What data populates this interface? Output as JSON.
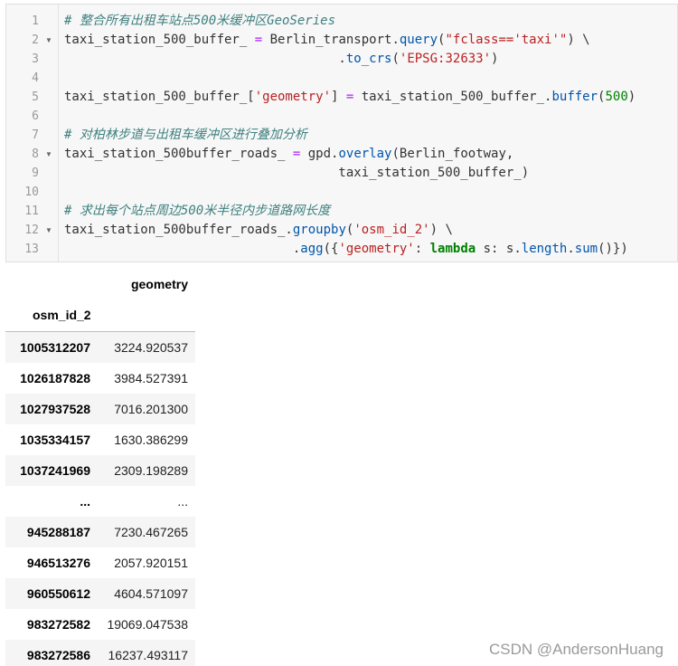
{
  "code_cell": {
    "lines": [
      {
        "num": "1",
        "fold": "",
        "tokens": [
          {
            "t": "# 整合所有出租车站点500米缓冲区GeoSeries",
            "c": "tk-comment"
          }
        ]
      },
      {
        "num": "2",
        "fold": "▼",
        "tokens": [
          {
            "t": "taxi_station_500_buffer_ ",
            "c": "tk-plain"
          },
          {
            "t": "=",
            "c": "tk-op"
          },
          {
            "t": " Berlin_transport.",
            "c": "tk-plain"
          },
          {
            "t": "query",
            "c": "tk-attr"
          },
          {
            "t": "(",
            "c": "tk-plain"
          },
          {
            "t": "\"fclass=='taxi'\"",
            "c": "tk-str"
          },
          {
            "t": ") \\",
            "c": "tk-plain"
          }
        ]
      },
      {
        "num": "3",
        "fold": "",
        "tokens": [
          {
            "t": "                                    .",
            "c": "tk-plain"
          },
          {
            "t": "to_crs",
            "c": "tk-attr"
          },
          {
            "t": "(",
            "c": "tk-plain"
          },
          {
            "t": "'EPSG:32633'",
            "c": "tk-str"
          },
          {
            "t": ")",
            "c": "tk-plain"
          }
        ]
      },
      {
        "num": "4",
        "fold": "",
        "tokens": []
      },
      {
        "num": "5",
        "fold": "",
        "tokens": [
          {
            "t": "taxi_station_500_buffer_[",
            "c": "tk-plain"
          },
          {
            "t": "'geometry'",
            "c": "tk-str"
          },
          {
            "t": "] ",
            "c": "tk-plain"
          },
          {
            "t": "=",
            "c": "tk-op"
          },
          {
            "t": " taxi_station_500_buffer_.",
            "c": "tk-plain"
          },
          {
            "t": "buffer",
            "c": "tk-attr"
          },
          {
            "t": "(",
            "c": "tk-plain"
          },
          {
            "t": "500",
            "c": "tk-num"
          },
          {
            "t": ")",
            "c": "tk-plain"
          }
        ]
      },
      {
        "num": "6",
        "fold": "",
        "tokens": []
      },
      {
        "num": "7",
        "fold": "",
        "tokens": [
          {
            "t": "# 对柏林步道与出租车缓冲区进行叠加分析",
            "c": "tk-comment"
          }
        ]
      },
      {
        "num": "8",
        "fold": "▼",
        "tokens": [
          {
            "t": "taxi_station_500buffer_roads_ ",
            "c": "tk-plain"
          },
          {
            "t": "=",
            "c": "tk-op"
          },
          {
            "t": " gpd.",
            "c": "tk-plain"
          },
          {
            "t": "overlay",
            "c": "tk-attr"
          },
          {
            "t": "(Berlin_footway,",
            "c": "tk-plain"
          }
        ]
      },
      {
        "num": "9",
        "fold": "",
        "tokens": [
          {
            "t": "                                    taxi_station_500_buffer_)",
            "c": "tk-plain"
          }
        ]
      },
      {
        "num": "10",
        "fold": "",
        "tokens": []
      },
      {
        "num": "11",
        "fold": "",
        "tokens": [
          {
            "t": "# 求出每个站点周边500米半径内步道路网长度",
            "c": "tk-comment"
          }
        ]
      },
      {
        "num": "12",
        "fold": "▼",
        "tokens": [
          {
            "t": "taxi_station_500buffer_roads_.",
            "c": "tk-plain"
          },
          {
            "t": "groupby",
            "c": "tk-attr"
          },
          {
            "t": "(",
            "c": "tk-plain"
          },
          {
            "t": "'osm_id_2'",
            "c": "tk-str"
          },
          {
            "t": ") \\",
            "c": "tk-plain"
          }
        ]
      },
      {
        "num": "13",
        "fold": "",
        "tokens": [
          {
            "t": "                              .",
            "c": "tk-plain"
          },
          {
            "t": "agg",
            "c": "tk-attr"
          },
          {
            "t": "({",
            "c": "tk-plain"
          },
          {
            "t": "'geometry'",
            "c": "tk-str"
          },
          {
            "t": ": ",
            "c": "tk-plain"
          },
          {
            "t": "lambda",
            "c": "tk-kw"
          },
          {
            "t": " s: s.",
            "c": "tk-plain"
          },
          {
            "t": "length",
            "c": "tk-attr"
          },
          {
            "t": ".",
            "c": "tk-plain"
          },
          {
            "t": "sum",
            "c": "tk-attr"
          },
          {
            "t": "()})",
            "c": "tk-plain"
          }
        ]
      }
    ]
  },
  "dataframe": {
    "column_header": "geometry",
    "index_name": "osm_id_2",
    "rows": [
      {
        "index": "1005312207",
        "value": "3224.920537"
      },
      {
        "index": "1026187828",
        "value": "3984.527391"
      },
      {
        "index": "1027937528",
        "value": "7016.201300"
      },
      {
        "index": "1035334157",
        "value": "1630.386299"
      },
      {
        "index": "1037241969",
        "value": "2309.198289"
      },
      {
        "index": "...",
        "value": "..."
      },
      {
        "index": "945288187",
        "value": "7230.467265"
      },
      {
        "index": "946513276",
        "value": "2057.920151"
      },
      {
        "index": "960550612",
        "value": "4604.571097"
      },
      {
        "index": "983272582",
        "value": "19069.047538"
      },
      {
        "index": "983272586",
        "value": "16237.493117"
      }
    ]
  },
  "watermark": "CSDN @AndersonHuang"
}
